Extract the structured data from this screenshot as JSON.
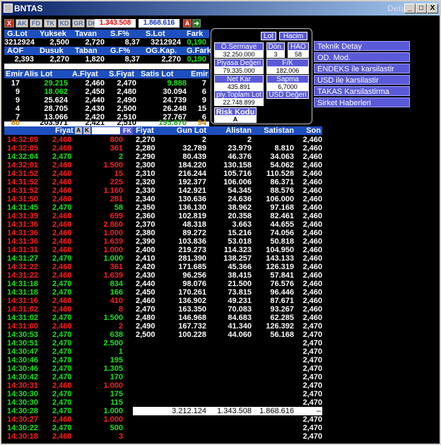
{
  "window": {
    "title": "BNTAS",
    "subtitle": "Detay",
    "btn_min": "_",
    "btn_max": "□",
    "btn_close": "X"
  },
  "toolbar": {
    "buttons": [
      "X",
      "AK",
      "FD",
      "TK",
      "KD",
      "GR",
      "DK"
    ],
    "price_red": "1.343.508",
    "price_blue": "1.868.616",
    "btn_a": "A"
  },
  "summary": {
    "row1_headers": [
      "G.Lot",
      "Yuksek",
      "Tavan",
      "S.F%",
      "S.Lot",
      "Fark"
    ],
    "row1_values": [
      "3212924",
      "2,500",
      "2,720",
      "8,37",
      "3212924",
      "0,190"
    ],
    "row2_headers": [
      "AOF",
      "Dusuk",
      "Taban",
      "G.F%",
      "OG.Kap.",
      "G.Fark"
    ],
    "row2_values": [
      "2,393",
      "2,270",
      "1,820",
      "8,37",
      "2,270",
      "0,190"
    ]
  },
  "depth": {
    "headers": [
      "Emir",
      "Alis Lot",
      "A.Fiyat",
      "S.Fiyat",
      "Satis Lot",
      "Emir"
    ],
    "rows": [
      [
        "17",
        "29.215",
        "2,460",
        "2,470",
        "9.888",
        "7"
      ],
      [
        "9",
        "18.062",
        "2,450",
        "2,480",
        "30.094",
        "6"
      ],
      [
        "9",
        "25.624",
        "2,440",
        "2,490",
        "24.739",
        "9"
      ],
      [
        "4",
        "28.705",
        "2,430",
        "2,500",
        "26.248",
        "15"
      ],
      [
        "7",
        "13.066",
        "2,420",
        "2,510",
        "27.767",
        "6"
      ]
    ],
    "total": [
      "80",
      "203.971",
      "2,421",
      "2,510",
      "195.870",
      "94"
    ]
  },
  "popup": {
    "lot": "Lot",
    "hacim": "Hacim",
    "osermaye_label": "Ö.Sermaye",
    "osermaye": "32.250.000",
    "don_label": "Dön.",
    "don": "3",
    "hao_label": "HAO",
    "hao": "58",
    "piyasa_label": "Piyasa Değeri",
    "piyasa": "79.335.000",
    "fk_label": "F/K",
    "fk": "182,006",
    "netkar_label": "Net Kar",
    "netkar": "435.891",
    "sapma_label": "Sapma",
    "sapma": "6,7000",
    "piy_label": "piy.Toplam Lot",
    "piy": "22.748.899",
    "usd_label": "USD Değeri",
    "risk_label": "Risk Kodu",
    "risk": "A"
  },
  "menu": [
    "Teknik Detay",
    "OD. Mod.",
    "ENDEKS ile karsilastir",
    "USD ile karsilastir",
    "TAKAS Karsilastirma",
    "Sirket Haberleri"
  ],
  "trades": {
    "headers": {
      "fiyat": "Fiyat",
      "a": "A",
      "k": "K",
      "fk": "FK"
    },
    "rows": [
      [
        "14:32:09",
        "2,460",
        "800",
        "r"
      ],
      [
        "14:32:05",
        "2,460",
        "361",
        "r"
      ],
      [
        "14:32:04",
        "2,470",
        "2",
        "g"
      ],
      [
        "14:32:01",
        "2,460",
        "1.500",
        "r"
      ],
      [
        "14:31:52",
        "2,460",
        "15",
        "r"
      ],
      [
        "14:31:52",
        "2,460",
        "225",
        "r"
      ],
      [
        "14:31:52",
        "2,460",
        "1.160",
        "r"
      ],
      [
        "14:31:50",
        "2,460",
        "281",
        "r"
      ],
      [
        "14:31:45",
        "2,470",
        "58",
        "g"
      ],
      [
        "14:31:39",
        "2,460",
        "699",
        "r"
      ],
      [
        "14:31:36",
        "2,460",
        "2.860",
        "r"
      ],
      [
        "14:31:36",
        "2,460",
        "1.000",
        "r"
      ],
      [
        "14:31:36",
        "2,460",
        "1.639",
        "r"
      ],
      [
        "14:31:31",
        "2,460",
        "1.000",
        "r"
      ],
      [
        "14:31:27",
        "2,470",
        "1.000",
        "g"
      ],
      [
        "14:31:22",
        "2,460",
        "361",
        "r"
      ],
      [
        "14:31:22",
        "2,460",
        "1.639",
        "r"
      ],
      [
        "14:31:18",
        "2,470",
        "834",
        "g"
      ],
      [
        "14:31:18",
        "2,470",
        "166",
        "g"
      ],
      [
        "14:31:16",
        "2,460",
        "410",
        "r"
      ],
      [
        "14:31:02",
        "2,460",
        "8",
        "r"
      ],
      [
        "14:31:02",
        "2,470",
        "1.500",
        "g"
      ],
      [
        "14:31:00",
        "2,460",
        "2",
        "r"
      ],
      [
        "14:30:53",
        "2,470",
        "638",
        "g"
      ],
      [
        "14:30:51",
        "2,470",
        "2.500",
        "g"
      ],
      [
        "14:30:47",
        "2,470",
        "1",
        "g"
      ],
      [
        "14:30:46",
        "2,470",
        "195",
        "g"
      ],
      [
        "14:30:46",
        "2,470",
        "1.305",
        "g"
      ],
      [
        "14:30:42",
        "2,470",
        "170",
        "g"
      ],
      [
        "14:30:31",
        "2,460",
        "1.000",
        "r"
      ],
      [
        "14:30:30",
        "2,470",
        "175",
        "g"
      ],
      [
        "14:30:30",
        "2,470",
        "115",
        "g"
      ],
      [
        "14:30:28",
        "2,470",
        "1.000",
        "g"
      ],
      [
        "14:30:27",
        "2,460",
        "1.000",
        "r"
      ],
      [
        "14:30:22",
        "2,470",
        "500",
        "g"
      ],
      [
        "14:30:18",
        "2,460",
        "3",
        "r"
      ]
    ]
  },
  "volume": {
    "headers": [
      "Fiyat",
      "Gun Lot",
      "Alistan",
      "Satistan",
      "Son"
    ],
    "rows": [
      [
        "2,270",
        "2",
        "2",
        "",
        ""
      ],
      [
        "2,280",
        "32.789",
        "23.979",
        "8.810",
        ""
      ],
      [
        "2,290",
        "80.439",
        "46.376",
        "34.063",
        ""
      ],
      [
        "2,300",
        "184.220",
        "130.158",
        "54.062",
        ""
      ],
      [
        "2,310",
        "216.244",
        "105.716",
        "110.528",
        ""
      ],
      [
        "2,320",
        "192.377",
        "106.006",
        "86.371",
        ""
      ],
      [
        "2,330",
        "142.921",
        "54.345",
        "88.576",
        ""
      ],
      [
        "2,340",
        "130.636",
        "24.636",
        "106.000",
        ""
      ],
      [
        "2,350",
        "136.130",
        "38.962",
        "97.168",
        ""
      ],
      [
        "2,360",
        "102.819",
        "20.358",
        "82.461",
        ""
      ],
      [
        "2,370",
        "48.318",
        "3.663",
        "44.655",
        ""
      ],
      [
        "2,380",
        "89.272",
        "15.216",
        "74.056",
        ""
      ],
      [
        "2,390",
        "103.836",
        "53.018",
        "50.818",
        ""
      ],
      [
        "2,400",
        "219.273",
        "114.323",
        "104.950",
        ""
      ],
      [
        "2,410",
        "281.390",
        "138.257",
        "143.133",
        ""
      ],
      [
        "2,420",
        "171.685",
        "45.366",
        "126.319",
        ""
      ],
      [
        "2,430",
        "96.256",
        "38.415",
        "57.841",
        ""
      ],
      [
        "2,440",
        "98.076",
        "21.500",
        "76.576",
        ""
      ],
      [
        "2,450",
        "170.261",
        "73.815",
        "96.446",
        ""
      ],
      [
        "2,460",
        "136.902",
        "49.231",
        "87.671",
        ""
      ],
      [
        "2,470",
        "163.350",
        "70.083",
        "93.267",
        ""
      ],
      [
        "2,480",
        "146.968",
        "84.683",
        "62.285",
        ""
      ],
      [
        "2,490",
        "167.732",
        "41.340",
        "126.392",
        ""
      ],
      [
        "2,500",
        "100.228",
        "44.060",
        "56.168",
        ""
      ]
    ],
    "son": [
      "2,460",
      "2,460",
      "2,460",
      "2,460",
      "2,460",
      "2,460",
      "2,460",
      "2,460",
      "2,460",
      "2,460",
      "2,460",
      "2,460",
      "2,460",
      "2,460",
      "2,460",
      "2,460",
      "2,460",
      "2,460",
      "2,460",
      "2,460",
      "2,460",
      "2,460",
      "2,470",
      "2,470",
      "2,470",
      "2,470",
      "2,470",
      "2,470",
      "2,470",
      "2,470",
      "2,470",
      "2,470",
      "2,470",
      "2,470",
      "2,470",
      "2,470"
    ],
    "totals": [
      "3.212.124",
      "1.343.508",
      "1.868.616",
      "–"
    ]
  }
}
